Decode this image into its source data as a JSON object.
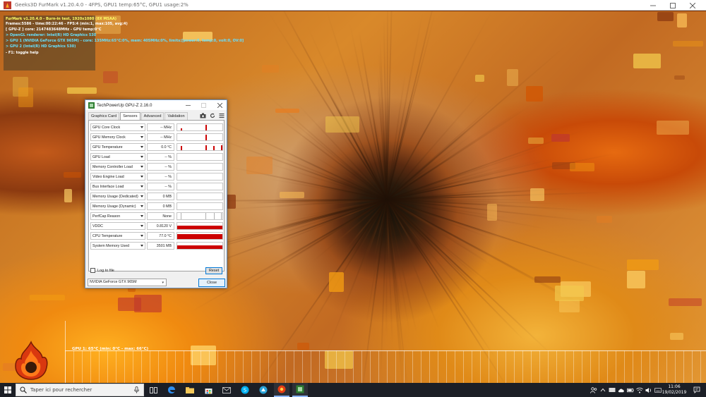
{
  "window": {
    "title": "Geeks3D FurMark v1.20.4.0 - 4FPS, GPU1 temp:65°C, GPU1 usage:2%"
  },
  "furmark": {
    "overlay": [
      "FurMark v1.20.4.0 - Burn-in test, 1920x1080 (8X MSAA)",
      "Frames:5586 - time:00:22:46 - FPS:4 (min:1, max:105, avg:4)",
      "[ GPU-Z ] core: 2147483648MHz - GPU temp:0°C",
      "> OpenGL renderer: Intel(R) HD Graphics 530",
      "> GPU 1 (NVIDIA GeForce GTX 965M) - core: 135MHz:65°C:0%, mem: 405MHz:0%, limits:[power:0, temp:0, volt:0, OV:0]",
      "> GPU 2 (Intel(R) HD Graphics 530)",
      "- F1: toggle help"
    ],
    "graph_label": "GPU 1: 65°C (min: 0°C - max: 66°C)"
  },
  "gpuz": {
    "title": "TechPowerUp GPU-Z 2.16.0",
    "tabs": [
      "Graphics Card",
      "Sensors",
      "Advanced",
      "Validation"
    ],
    "active_tab": "Sensors",
    "sensors": [
      {
        "name": "GPU Core Clock",
        "value": "-- MHz"
      },
      {
        "name": "GPU Memory Clock",
        "value": "-- MHz"
      },
      {
        "name": "GPU Temperature",
        "value": "0.0 °C"
      },
      {
        "name": "GPU Load",
        "value": "-- %"
      },
      {
        "name": "Memory Controller Load",
        "value": "-- %"
      },
      {
        "name": "Video Engine Load",
        "value": "-- %"
      },
      {
        "name": "Bus Interface Load",
        "value": "-- %"
      },
      {
        "name": "Memory Usage (Dedicated)",
        "value": "0 MB"
      },
      {
        "name": "Memory Usage (Dynamic)",
        "value": "0 MB"
      },
      {
        "name": "PerfCap Reason",
        "value": "None"
      },
      {
        "name": "VDDC",
        "value": "0.8120 V"
      },
      {
        "name": "CPU Temperature",
        "value": "77.0 °C"
      },
      {
        "name": "System Memory Used",
        "value": "3501 MB"
      }
    ],
    "log_to_file": "Log to file",
    "reset": "Reset",
    "selected_gpu": "NVIDIA GeForce GTX 965M",
    "close": "Close"
  },
  "taskbar": {
    "search_placeholder": "Taper ici pour rechercher",
    "time": "11:06",
    "date": "19/02/2019"
  },
  "colors": {
    "sensor_graph": "#cc0000",
    "taskbar": "#1c1f26"
  },
  "icons": [
    "windows-start-icon",
    "search-icon",
    "microphone-icon",
    "task-view-icon",
    "edge-icon",
    "file-explorer-icon",
    "store-icon",
    "mail-icon",
    "skype-icon",
    "app-icon",
    "furmark-icon",
    "gpuz-icon",
    "people-icon",
    "network-icon",
    "volume-icon",
    "notification-icon"
  ]
}
